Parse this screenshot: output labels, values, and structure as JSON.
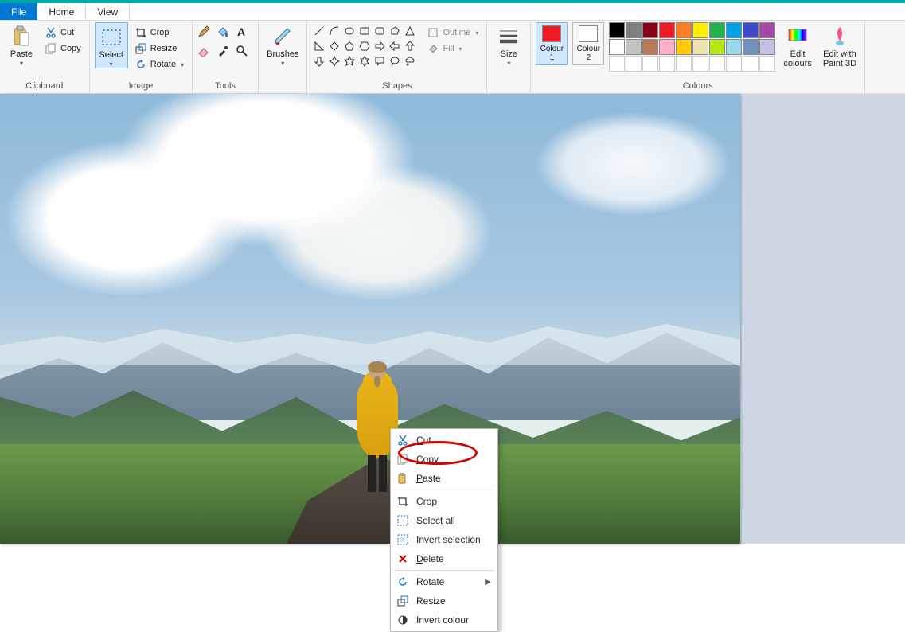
{
  "menutabs": {
    "file": "File",
    "home": "Home",
    "view": "View"
  },
  "ribbon": {
    "clipboard": {
      "label": "Clipboard",
      "paste": "Paste",
      "cut": "Cut",
      "copy": "Copy"
    },
    "image": {
      "label": "Image",
      "select": "Select",
      "crop": "Crop",
      "resize": "Resize",
      "rotate": "Rotate"
    },
    "tools": {
      "label": "Tools"
    },
    "brushes": {
      "label": "Brushes",
      "btn": "Brushes"
    },
    "shapes": {
      "label": "Shapes",
      "outline": "Outline",
      "fill": "Fill"
    },
    "size": {
      "label": "Size",
      "btn": "Size"
    },
    "colours": {
      "label": "Colours",
      "colour1": "Colour\n1",
      "colour2": "Colour\n2",
      "edit": "Edit\ncolours",
      "paint3d": "Edit with\nPaint 3D",
      "colour1_value": "#ed1c24",
      "colour2_value": "#ffffff",
      "palette_row1": [
        "#000000",
        "#7f7f7f",
        "#880015",
        "#ed1c24",
        "#ff7f27",
        "#fff200",
        "#22b14c",
        "#00a2e8",
        "#3f48cc",
        "#a349a4"
      ],
      "palette_row2": [
        "#ffffff",
        "#c3c3c3",
        "#b97a57",
        "#ffaec9",
        "#ffc90e",
        "#efe4b0",
        "#b5e61d",
        "#99d9ea",
        "#7092be",
        "#c8bfe7"
      ]
    }
  },
  "context_menu": {
    "cut": "Cut",
    "copy": "Copy",
    "paste": "Paste",
    "crop": "Crop",
    "select_all": "Select all",
    "invert_selection": "Invert selection",
    "delete": "Delete",
    "rotate": "Rotate",
    "resize": "Resize",
    "invert_colour": "Invert colour"
  },
  "annotation": {
    "highlighted_item": "copy"
  }
}
